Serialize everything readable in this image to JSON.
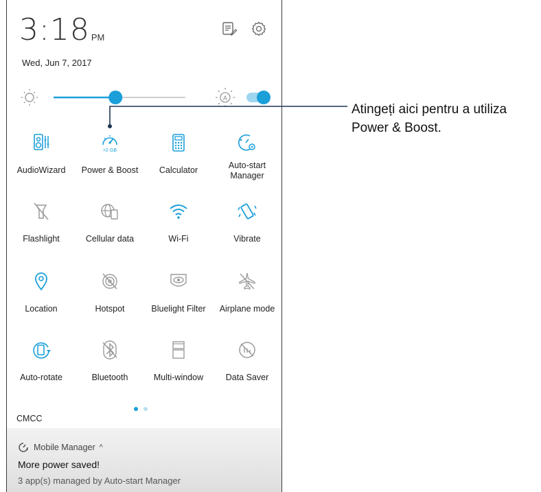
{
  "status": {
    "time": "3:18",
    "ampm": "PM",
    "date": "Wed, Jun 7, 2017"
  },
  "header_icons": [
    "edit-list-icon",
    "gear-icon"
  ],
  "brightness": {
    "level": 0.47,
    "auto_enabled": true
  },
  "tiles": [
    {
      "label": "AudioWizard",
      "icon": "audiowizard-icon",
      "active": true
    },
    {
      "label": "Power & Boost",
      "icon": "power-boost-icon",
      "active": true,
      "badge": ">2 GB"
    },
    {
      "label": "Calculator",
      "icon": "calculator-icon",
      "active": true
    },
    {
      "label": "Auto-start\nManager",
      "icon": "autostart-icon",
      "active": true
    },
    {
      "label": "Flashlight",
      "icon": "flashlight-icon",
      "active": false
    },
    {
      "label": "Cellular data",
      "icon": "cellular-data-icon",
      "active": false
    },
    {
      "label": "Wi-Fi",
      "icon": "wifi-icon",
      "active": true
    },
    {
      "label": "Vibrate",
      "icon": "vibrate-icon",
      "active": true
    },
    {
      "label": "Location",
      "icon": "location-icon",
      "active": true
    },
    {
      "label": "Hotspot",
      "icon": "hotspot-icon",
      "active": false
    },
    {
      "label": "Bluelight Filter",
      "icon": "bluelight-filter-icon",
      "active": false
    },
    {
      "label": "Airplane mode",
      "icon": "airplane-icon",
      "active": false
    },
    {
      "label": "Auto-rotate",
      "icon": "auto-rotate-icon",
      "active": true
    },
    {
      "label": "Bluetooth",
      "icon": "bluetooth-icon",
      "active": false
    },
    {
      "label": "Multi-window",
      "icon": "multi-window-icon",
      "active": false
    },
    {
      "label": "Data Saver",
      "icon": "data-saver-icon",
      "active": false
    }
  ],
  "page_indicator": {
    "pages": 2,
    "current": 0
  },
  "carrier": "CMCC",
  "notification": {
    "app": "Mobile Manager",
    "title": "More power saved!",
    "body": "3 app(s) managed by Auto-start Manager"
  },
  "callout": {
    "line1": "Atingeți aici pentru a utiliza",
    "line2": "Power & Boost."
  },
  "colors": {
    "accent": "#1a9fd9",
    "inactive": "#9a9a9a",
    "callout_line": "#1f3552"
  }
}
